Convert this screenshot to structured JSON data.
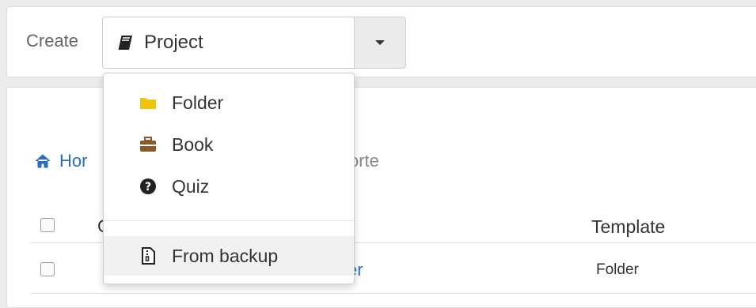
{
  "toolbar": {
    "create_label": "Create",
    "selected_type": "Project",
    "selected_icon": "notebook-icon"
  },
  "dropdown": {
    "items": [
      {
        "label": "Folder",
        "icon": "folder-icon",
        "color": "#f0c30f"
      },
      {
        "label": "Book",
        "icon": "briefcase-icon",
        "color": "#8b5a2b"
      },
      {
        "label": "Quiz",
        "icon": "question-circle-icon",
        "color": "#222222"
      }
    ],
    "backup_item": {
      "label": "From backup",
      "icon": "file-archive-icon"
    }
  },
  "breadcrumb": {
    "home_visible": "Hor",
    "tail_visible": "orte"
  },
  "table": {
    "header_first_visible": "C",
    "header_template": "Template",
    "rows": [
      {
        "name_visible": "er",
        "template": "Folder"
      }
    ]
  },
  "colors": {
    "link": "#2a6ebb",
    "folder": "#f0c30f",
    "book": "#8b5a2b"
  }
}
